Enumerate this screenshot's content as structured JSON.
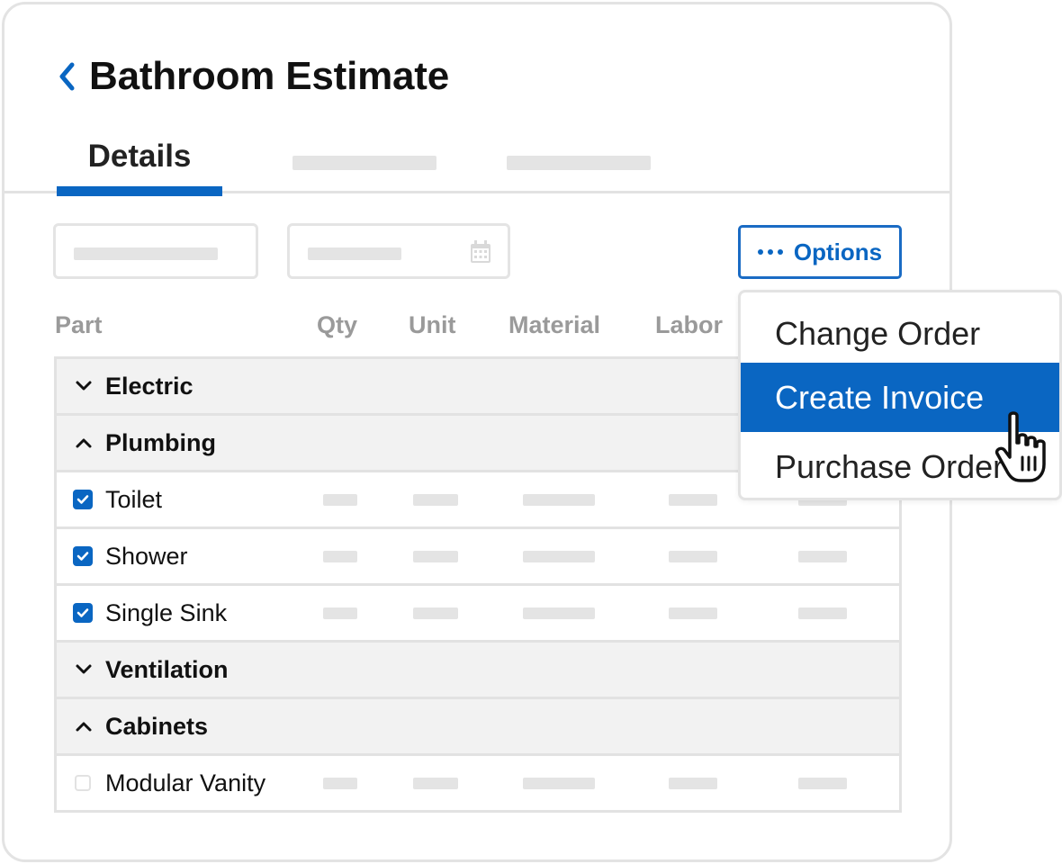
{
  "header": {
    "title": "Bathroom Estimate",
    "back_icon": "chevron-left-icon"
  },
  "tabs": [
    {
      "label": "Details",
      "active": true
    },
    {
      "label": "",
      "placeholder": true
    },
    {
      "label": "",
      "placeholder": true
    }
  ],
  "toolbar": {
    "options_label": "Options",
    "options_icon": "more-horizontal-icon",
    "date_icon": "calendar-icon"
  },
  "columns": [
    "Part",
    "Qty",
    "Unit",
    "Material",
    "Labor"
  ],
  "rows": [
    {
      "type": "group",
      "label": "Electric",
      "expanded": false
    },
    {
      "type": "group",
      "label": "Plumbing",
      "expanded": true
    },
    {
      "type": "item",
      "label": "Toilet",
      "checked": true
    },
    {
      "type": "item",
      "label": "Shower",
      "checked": true
    },
    {
      "type": "item",
      "label": "Single Sink",
      "checked": true
    },
    {
      "type": "group",
      "label": "Ventilation",
      "expanded": false
    },
    {
      "type": "group",
      "label": "Cabinets",
      "expanded": true
    },
    {
      "type": "item",
      "label": "Modular Vanity",
      "checked": false
    }
  ],
  "options_menu": {
    "items": [
      "Change Order",
      "Create Invoice",
      "Purchase Order"
    ],
    "highlighted": "Create Invoice"
  },
  "colors": {
    "accent": "#0a66c2",
    "group_bg": "#f2f2f2",
    "border": "#e2e2e2",
    "muted": "#9a9a9a"
  }
}
